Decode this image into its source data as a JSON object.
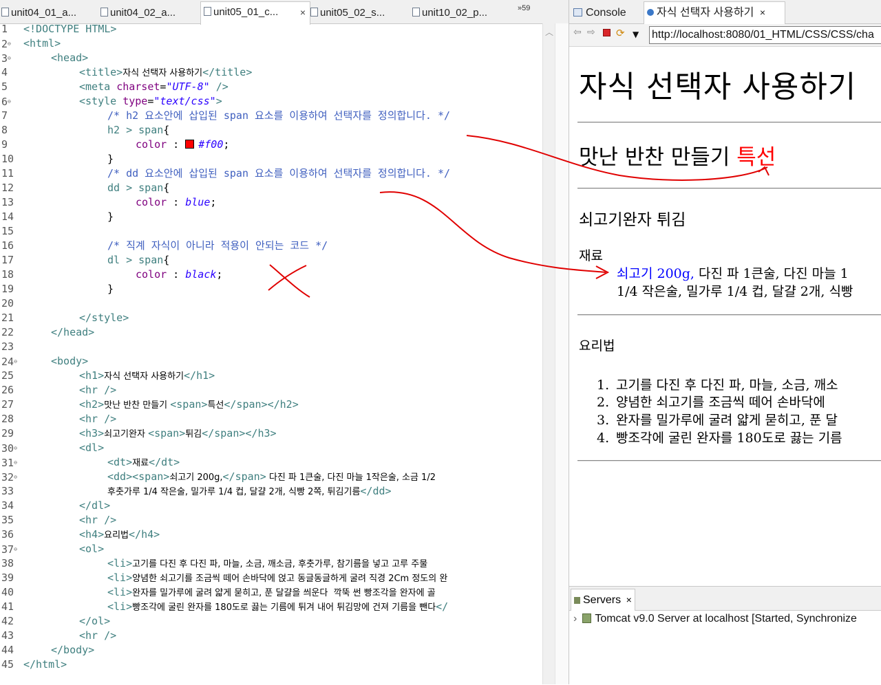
{
  "editor": {
    "tabs": [
      {
        "label": "unit04_01_a..."
      },
      {
        "label": "unit04_02_a..."
      },
      {
        "label": "unit05_01_c...",
        "close": "×"
      },
      {
        "label": "unit05_02_s..."
      },
      {
        "label": "unit10_02_p..."
      }
    ],
    "overflow_label": "»59",
    "line_numbers": [
      "1",
      "2",
      "3",
      "4",
      "5",
      "6",
      "7",
      "8",
      "9",
      "10",
      "11",
      "12",
      "13",
      "14",
      "15",
      "16",
      "17",
      "18",
      "19",
      "20",
      "21",
      "22",
      "23",
      "24",
      "25",
      "26",
      "27",
      "28",
      "29",
      "30",
      "31",
      "32",
      "33",
      "34",
      "35",
      "36",
      "37",
      "38",
      "39",
      "40",
      "41",
      "42",
      "43",
      "44",
      "45"
    ],
    "fold_marker": "⊖",
    "code": {
      "l1": {
        "a": "<!DOCTYPE HTML>"
      },
      "l2": {
        "a": "<html>"
      },
      "l3": {
        "a": "<head>"
      },
      "l4": {
        "a": "<title>",
        "b": "자식 선택자 사용하기",
        "c": "</title>"
      },
      "l5": {
        "a": "<meta",
        "b": "charset",
        "c": "=",
        "d": "\"UTF-8\"",
        "e": "/>"
      },
      "l6": {
        "a": "<style",
        "b": "type",
        "c": "=",
        "d": "\"text/css\"",
        "e": ">"
      },
      "l7": {
        "a": "/* h2 요소안에 삽입된 span 요소를 이용하여 선택자를 정의합니다. */"
      },
      "l8": {
        "a": "h2 > span",
        "b": "{"
      },
      "l9": {
        "a": "color",
        "b": " : ",
        "c": "#f00",
        "d": ";"
      },
      "l10": {
        "a": "}"
      },
      "l11": {
        "a": "/* dd 요소안에 삽입된 span 요소를 이용하여 선택자를 정의합니다. */"
      },
      "l12": {
        "a": "dd > span",
        "b": "{"
      },
      "l13": {
        "a": "color",
        "b": " : ",
        "c": "blue",
        "d": ";"
      },
      "l14": {
        "a": "}"
      },
      "l16": {
        "a": "/* 직계 자식이 아니라 적용이 안되는 코드 */"
      },
      "l17": {
        "a": "dl > span",
        "b": "{"
      },
      "l18": {
        "a": "color",
        "b": " : ",
        "c": "black",
        "d": ";"
      },
      "l19": {
        "a": "}"
      },
      "l21": {
        "a": "</style>"
      },
      "l22": {
        "a": "</head>"
      },
      "l24": {
        "a": "<body>"
      },
      "l25": {
        "a": "<h1>",
        "b": "자식 선택자 사용하기",
        "c": "</h1>"
      },
      "l26": {
        "a": "<hr />"
      },
      "l27": {
        "a": "<h2>",
        "b": "맛난 반찬 만들기 ",
        "c": "<span>",
        "d": "특선",
        "e": "</span></h2>"
      },
      "l28": {
        "a": "<hr />"
      },
      "l29": {
        "a": "<h3>",
        "b": "쇠고기완자 ",
        "c": "<span>",
        "d": "튀김",
        "e": "</span></h3>"
      },
      "l30": {
        "a": "<dl>"
      },
      "l31": {
        "a": "<dt>",
        "b": "재료",
        "c": "</dt>"
      },
      "l32": {
        "a": "<dd><span>",
        "b": "쇠고기 200g,",
        "c": "</span>",
        "d": " 다진 파 1큰술, 다진 마늘 1작은술, 소금 1/2"
      },
      "l33": {
        "a": "후춧가루 1/4 작은술, 밀가루 1/4 컵, 달걀 2개, 식빵 2쪽, 튀김기름",
        "b": "</dd>"
      },
      "l34": {
        "a": "</dl>"
      },
      "l35": {
        "a": "<hr />"
      },
      "l36": {
        "a": "<h4>",
        "b": "요리법",
        "c": "</h4>"
      },
      "l37": {
        "a": "<ol>"
      },
      "l38": {
        "a": "<li>",
        "b": "고기를 다진 후 다진 파, 마늘, 소금, 깨소금, 후춧가루, 참기름을 넣고 고루 주물"
      },
      "l39": {
        "a": "<li>",
        "b": "양념한 쇠고기를 조금씩 떼어 손바닥에 얹고 동글동글하게 굴려 직경 2Cm 정도의 완"
      },
      "l40": {
        "a": "<li>",
        "b": "완자를 밀가루에 굴려 얇게 묻히고, 푼 달걀을 씌운다  깍뚝 썬 빵조각을 완자에 골"
      },
      "l41": {
        "a": "<li>",
        "b": "빵조각에 굴린 완자를 180도로 끓는 기름에 튀겨 내어 튀김망에 건져 기름을 뺀다",
        "c": "</"
      },
      "l42": {
        "a": "</ol>"
      },
      "l43": {
        "a": "<hr />"
      },
      "l44": {
        "a": "</body>"
      },
      "l45": {
        "a": "</html>"
      }
    }
  },
  "browser": {
    "tabs": {
      "console": "Console",
      "page": "자식 선택자 사용하기",
      "close": "×"
    },
    "url": "http://localhost:8080/01_HTML/CSS/CSS/cha",
    "page": {
      "h1": "자식 선택자 사용하기",
      "h2_text": "맛난 반찬 만들기 ",
      "h2_span": "특선",
      "h3": "쇠고기완자 튀김",
      "dt": "재료",
      "dd_span": "쇠고기 200g,",
      "dd_rest1": " 다진 파 1큰술, 다진 마늘 1",
      "dd_rest2": "1/4 작은술, 밀가루 1/4 컵, 달걀 2개, 식빵",
      "h4": "요리법",
      "steps": [
        {
          "num": "1.",
          "text": "고기를 다진 후 다진 파, 마늘, 소금, 깨소"
        },
        {
          "num": "2.",
          "text": "양념한 쇠고기를 조금씩 떼어 손바닥에"
        },
        {
          "num": "3.",
          "text": "완자를 밀가루에 굴려 얇게 묻히고, 푼 달"
        },
        {
          "num": "4.",
          "text": "빵조각에 굴린 완자를 180도로 끓는 기름"
        }
      ]
    }
  },
  "servers": {
    "tab_label": "Servers",
    "close": "×",
    "row": "Tomcat v9.0 Server at localhost  [Started, Synchronize"
  },
  "colors": {
    "h2_span": "#ff0000",
    "dd_span": "#0000ff",
    "annotation": "#e00000"
  }
}
